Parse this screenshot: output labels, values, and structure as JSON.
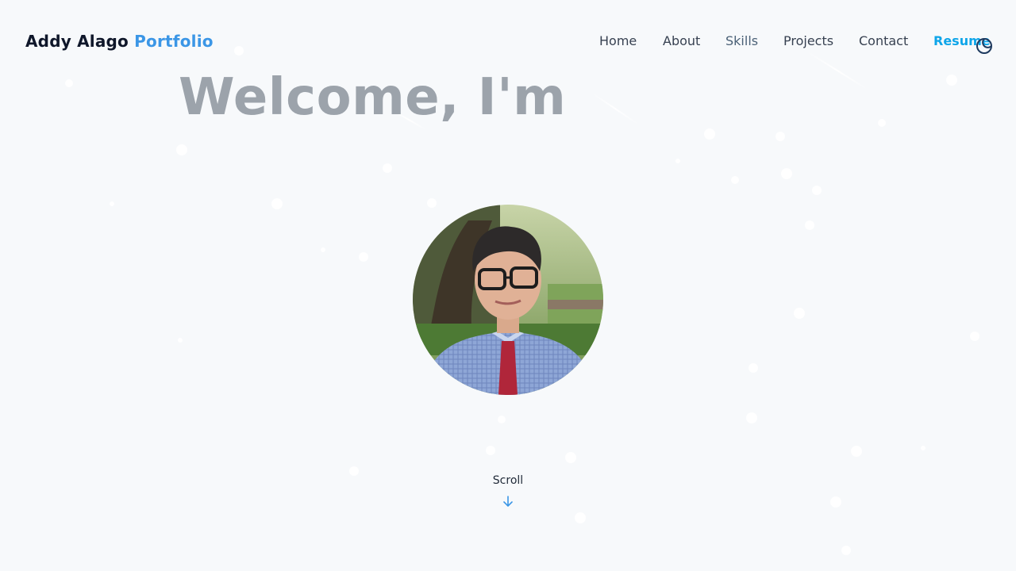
{
  "brand": {
    "name": "Addy Alago",
    "accent": "Portfolio"
  },
  "nav": {
    "items": [
      {
        "id": "home",
        "label": "Home"
      },
      {
        "id": "about",
        "label": "About"
      },
      {
        "id": "skills",
        "label": "Skills"
      },
      {
        "id": "projects",
        "label": "Projects"
      },
      {
        "id": "contact",
        "label": "Contact"
      },
      {
        "id": "resume",
        "label": "Resume"
      }
    ],
    "theme_toggle_icon": "moon-icon"
  },
  "hero": {
    "title": "Welcome, I'm",
    "avatar_icon": "profile-photo"
  },
  "scroll": {
    "label": "Scroll",
    "icon": "arrow-down-icon"
  },
  "colors": {
    "background": "#f7f9fb",
    "accent": "#3b96e6",
    "resume": "#0ea5e9",
    "title_gray": "#9ca3ab"
  }
}
